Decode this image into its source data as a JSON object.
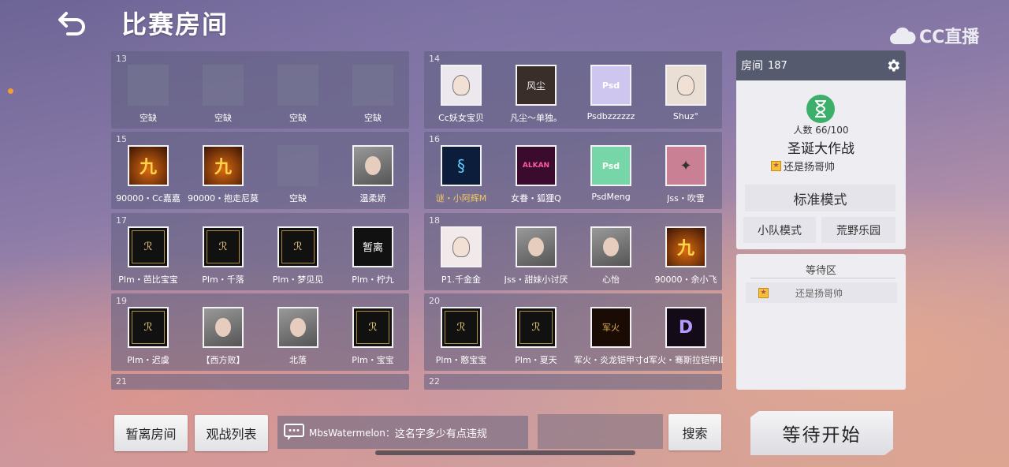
{
  "header": {
    "title": "比赛房间",
    "watermark": "CC直播"
  },
  "rooms": [
    {
      "num": "13",
      "slots": [
        {
          "name": "空缺",
          "empty": true
        },
        {
          "name": "空缺",
          "empty": true
        },
        {
          "name": "空缺",
          "empty": true
        },
        {
          "name": "空缺",
          "empty": true
        }
      ]
    },
    {
      "num": "14",
      "slots": [
        {
          "name": "Cc妖女宝贝",
          "bg": "#ece8ee",
          "art": "girl"
        },
        {
          "name": "凡尘～单独。",
          "bg": "#3a2e2a",
          "art": "风尘"
        },
        {
          "name": "Psdbzzzzzz",
          "bg": "#cfc6ef",
          "art": "Psd"
        },
        {
          "name": "Shuz°",
          "bg": "#e9dfd4",
          "art": "girl2"
        }
      ]
    },
    {
      "num": "15",
      "slots": [
        {
          "name": "90000・Cc嘉嘉",
          "bg": "#3e1d0b",
          "art": "九"
        },
        {
          "name": "90000・抱走尼莫",
          "bg": "#2c1306",
          "art": "九"
        },
        {
          "name": "空缺",
          "empty": true
        },
        {
          "name": "温柔娇",
          "bg": "#dcdcdc",
          "art": "photo"
        }
      ]
    },
    {
      "num": "16",
      "slots": [
        {
          "name": "谜・小阿辉M",
          "bg": "#0b1d3a",
          "art": "dragon",
          "gold": true
        },
        {
          "name": "女眷・狐狸Q",
          "bg": "#3a0b2c",
          "art": "ALKAN"
        },
        {
          "name": "PsdMeng",
          "bg": "#77d6a8",
          "art": "Psd"
        },
        {
          "name": "Jss・吹雪",
          "bg": "#c97f94",
          "art": "wing"
        }
      ]
    },
    {
      "num": "17",
      "slots": [
        {
          "name": "Plm・芭比宝宝",
          "bg": "#111",
          "art": "Plm"
        },
        {
          "name": "Plm・千落",
          "bg": "#111",
          "art": "Plm"
        },
        {
          "name": "Plm・梦见见",
          "bg": "#111",
          "art": "Plm"
        },
        {
          "name": "Plm・柠九",
          "bg": "#111",
          "art": "暂离"
        }
      ]
    },
    {
      "num": "18",
      "slots": [
        {
          "name": "P1.千金金",
          "bg": "#f2eaea",
          "art": "girl"
        },
        {
          "name": "Jss・甜妹小讨厌",
          "bg": "#cfd6c8",
          "art": "photo"
        },
        {
          "name": "心怡",
          "bg": "#bdbdbd",
          "art": "photo"
        },
        {
          "name": "90000・余小飞",
          "bg": "#3e0d06",
          "art": "九"
        }
      ]
    },
    {
      "num": "19",
      "slots": [
        {
          "name": "Plm・迟虞",
          "bg": "#111",
          "art": "Plm"
        },
        {
          "name": "【西方败】",
          "bg": "#d8c7b4",
          "art": "photo"
        },
        {
          "name": "北落",
          "bg": "#a98f77",
          "art": "photo"
        },
        {
          "name": "Plm・宝宝",
          "bg": "#111",
          "art": "Plm"
        }
      ]
    },
    {
      "num": "20",
      "slots": [
        {
          "name": "Plm・憨宝宝",
          "bg": "#111",
          "art": "Plm"
        },
        {
          "name": "Plm・夏天",
          "bg": "#111",
          "art": "Plm"
        },
        {
          "name": "军火・炎龙铠甲寸dd",
          "bg": "#1a0c05",
          "art": "军火"
        },
        {
          "name": "军火・骞斯拉铠甲ID",
          "bg": "#140b18",
          "art": "D"
        }
      ]
    },
    {
      "num": "21",
      "slots": []
    },
    {
      "num": "22",
      "slots": []
    }
  ],
  "panel": {
    "room_label": "房间",
    "room_id": "187",
    "people": "人数 66/100",
    "room_title": "圣诞大作战",
    "owner": "还是扬哥帅",
    "mode_standard": "标准模式",
    "mode_team": "小队模式",
    "mode_wild": "荒野乐园"
  },
  "waiting": {
    "title": "等待区",
    "items": [
      {
        "name": "还是扬哥帅"
      }
    ]
  },
  "bottom": {
    "leave_button": "暂离房间",
    "spectate_button": "观战列表",
    "chat_user": "MbsWatermelon：",
    "chat_text": "这名字多少有点违规",
    "search_placeholder": "",
    "search_button": "搜索",
    "start_button": "等待开始"
  },
  "colors": {
    "accent_green": "#3cb06a",
    "panel_header": "#565a6e",
    "gold_name": "#f3c960"
  }
}
